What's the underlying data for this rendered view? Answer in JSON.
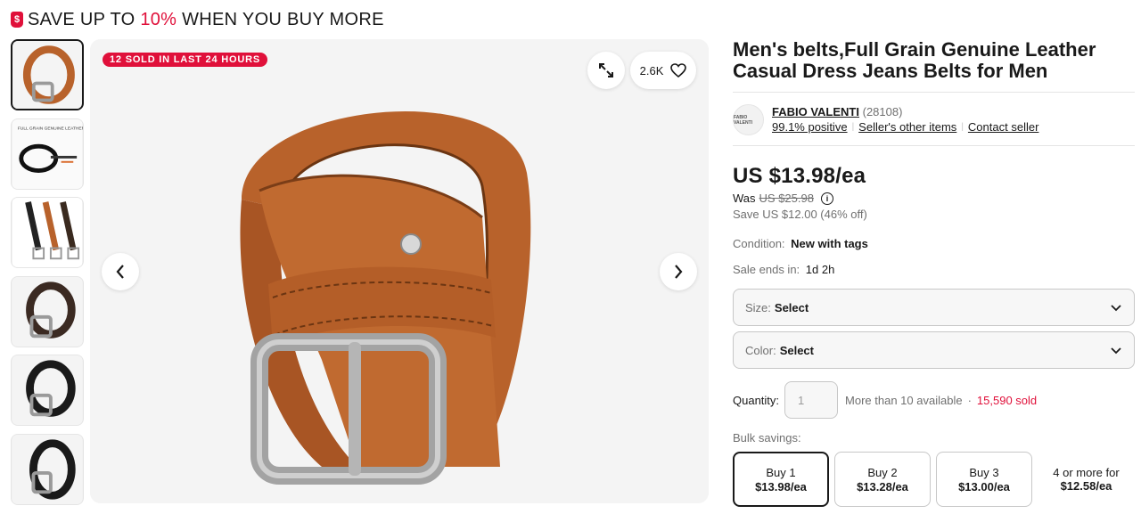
{
  "promo": {
    "icon": "sale-tag-icon",
    "prefix": "SAVE UP TO",
    "percent": "10%",
    "suffix": "WHEN YOU BUY MORE"
  },
  "gallery": {
    "thumbnails": [
      {
        "icon": "belt-brown-thumbnail",
        "active": true
      },
      {
        "icon": "belt-black-coiled-thumbnail",
        "active": false
      },
      {
        "icon": "belt-three-colors-thumbnail",
        "active": false
      },
      {
        "icon": "belt-dark-brown-thumbnail",
        "active": false
      },
      {
        "icon": "belt-black-thumbnail",
        "active": false
      },
      {
        "icon": "belt-black-side-thumbnail",
        "active": false
      }
    ],
    "sold_badge": "12 SOLD IN LAST 24 HOURS",
    "watch_count": "2.6K"
  },
  "product": {
    "title": "Men's belts,Full Grain Genuine Leather Casual Dress Jeans Belts for Men"
  },
  "seller": {
    "logo_text": "FABIO VALENTI",
    "name": "FABIO VALENTI",
    "feedback_count": "(28108)",
    "positive": "99.1% positive",
    "other_items": "Seller's other items",
    "contact": "Contact seller"
  },
  "pricing": {
    "price": "US $13.98/ea",
    "was_label": "Was",
    "was_price": "US $25.98",
    "save_text": "Save US $12.00 (46% off)"
  },
  "condition": {
    "label": "Condition:",
    "value": "New with tags"
  },
  "sale": {
    "label": "Sale ends in:",
    "value": "1d 2h"
  },
  "options": {
    "size": {
      "label": "Size:",
      "value": "Select"
    },
    "color": {
      "label": "Color:",
      "value": "Select"
    }
  },
  "quantity": {
    "label": "Quantity:",
    "placeholder": "1",
    "available": "More than 10 available",
    "sold": "15,590 sold"
  },
  "bulk": {
    "label": "Bulk savings:",
    "tiers": [
      {
        "qty": "Buy 1",
        "price": "$13.98/ea"
      },
      {
        "qty": "Buy 2",
        "price": "$13.28/ea"
      },
      {
        "qty": "Buy 3",
        "price": "$13.00/ea"
      }
    ],
    "more": {
      "qty": "4 or more for",
      "price": "$12.58/ea"
    }
  },
  "colors": {
    "accent_red": "#e0103a",
    "text": "#191919",
    "muted": "#707070",
    "belt_brown": "#b8622b"
  }
}
